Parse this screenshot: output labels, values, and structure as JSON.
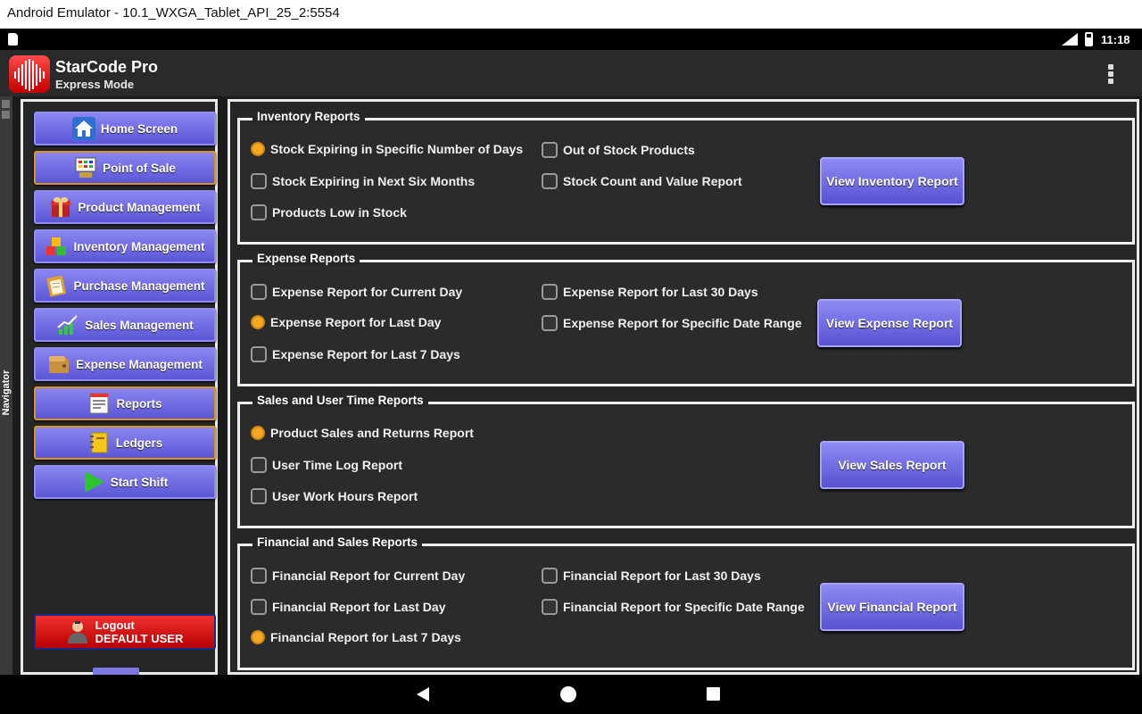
{
  "window": {
    "title": "Android Emulator - 10.1_WXGA_Tablet_API_25_2:5554"
  },
  "status_bar": {
    "time": "11:18",
    "icons": [
      "sd-card-icon",
      "signal-icon",
      "battery-icon"
    ]
  },
  "app_bar": {
    "title": "StarCode Pro",
    "subtitle": "Express Mode",
    "menu_icon": "overflow-menu-icon"
  },
  "navigator": {
    "label": "Navigator"
  },
  "sidebar": {
    "items": [
      {
        "label": "Home Screen",
        "icon": "home-icon"
      },
      {
        "label": "Point of Sale",
        "icon": "cash-register-icon"
      },
      {
        "label": "Product Management",
        "icon": "gift-box-icon"
      },
      {
        "label": "Inventory Management",
        "icon": "boxes-icon"
      },
      {
        "label": "Purchase Management",
        "icon": "clipboard-icon"
      },
      {
        "label": "Sales Management",
        "icon": "growth-chart-icon"
      },
      {
        "label": "Expense Management",
        "icon": "wallet-icon"
      },
      {
        "label": "Reports",
        "icon": "report-icon"
      },
      {
        "label": "Ledgers",
        "icon": "ledger-icon"
      },
      {
        "label": "Start Shift",
        "icon": "play-icon"
      }
    ],
    "logout": {
      "line1": "Logout",
      "line2": "DEFAULT USER",
      "icon": "user-icon"
    }
  },
  "groups": {
    "inventory": {
      "title": "Inventory Reports",
      "options": [
        "Stock Expiring in Specific Number of Days",
        "Stock Expiring in Next Six Months",
        "Products Low in Stock",
        "Out of Stock Products",
        "Stock Count and Value Report"
      ],
      "selected_index": 0,
      "button": "View Inventory Report"
    },
    "expense": {
      "title": "Expense Reports",
      "options": [
        "Expense Report for Current Day",
        "Expense Report for Last Day",
        "Expense Report for Last 7 Days",
        "Expense Report for Last 30 Days",
        "Expense Report for Specific Date Range"
      ],
      "selected_index": 1,
      "button": "View Expense Report"
    },
    "sales": {
      "title": "Sales and User Time Reports",
      "options": [
        "Product Sales and Returns Report",
        "User Time Log Report",
        "User Work Hours Report"
      ],
      "selected_index": 0,
      "button": "View Sales Report"
    },
    "financial": {
      "title": "Financial and Sales Reports",
      "options": [
        "Financial Report for Current Day",
        "Financial Report for Last Day",
        "Financial Report for Last 7 Days",
        "Financial Report for Last 30 Days",
        "Financial Report for Specific Date Range"
      ],
      "selected_index": 2,
      "button": "View Financial Report"
    }
  },
  "colors": {
    "accent": "#5b56d6",
    "radio_selected": "#f5a623",
    "logout": "#d40000"
  }
}
